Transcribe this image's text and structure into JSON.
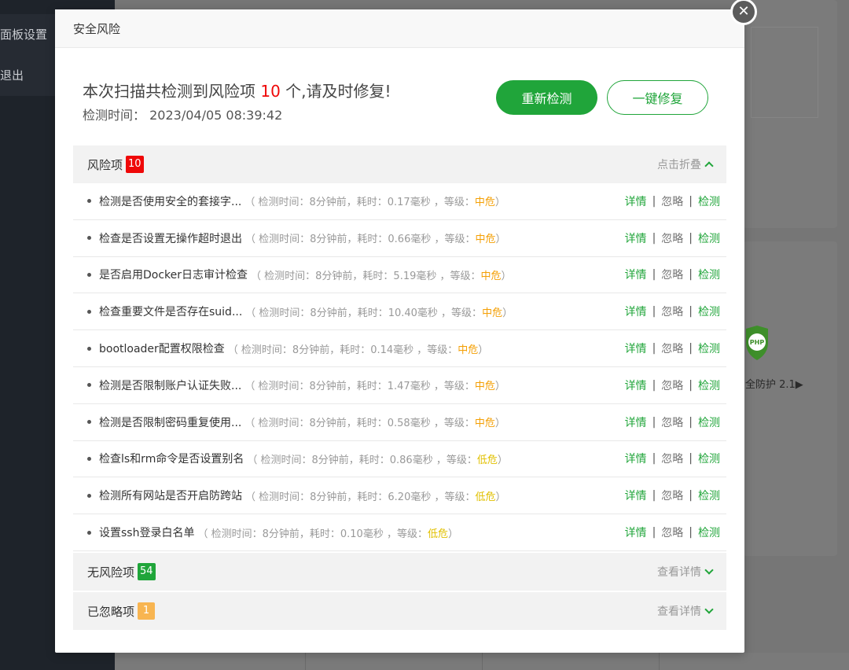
{
  "background": {
    "sidebar_items": [
      "面板设置",
      "退出"
    ],
    "guard_text": "全防护 2.1▶",
    "php_label": "PHP"
  },
  "modal": {
    "title": "安全风险",
    "close_glyph": "✕",
    "summary_prefix": "本次扫描共检测到风险项",
    "summary_count": "10",
    "summary_suffix": "个,请及时修复!",
    "scan_time_label": "检测时间：",
    "scan_time_value": "2023/04/05 08:39:42",
    "rescan_label": "重新检测",
    "fix_all_label": "一键修复",
    "risk_section": {
      "title": "风险项",
      "count": "10",
      "toggle_label": "点击折叠"
    },
    "safe_section": {
      "title": "无风险项",
      "count": "54",
      "toggle_label": "查看详情"
    },
    "ignored_section": {
      "title": "已忽略项",
      "count": "1",
      "toggle_label": "查看详情"
    },
    "actions": {
      "detail": "详情",
      "ignore": "忽略",
      "check": "检测",
      "separator": "|"
    },
    "risks": [
      {
        "name": "检测是否使用安全的套接字...",
        "meta_prefix": "（ 检测时间：8分钟前，耗时：0.17毫秒 ，等级：",
        "level": "中危",
        "meta_suffix": "）",
        "level_type": "mid"
      },
      {
        "name": "检查是否设置无操作超时退出",
        "meta_prefix": "（ 检测时间：8分钟前，耗时：0.66毫秒 ，等级：",
        "level": "中危",
        "meta_suffix": "）",
        "level_type": "mid"
      },
      {
        "name": "是否启用Docker日志审计检查",
        "meta_prefix": "（ 检测时间：8分钟前，耗时：5.19毫秒 ，等级：",
        "level": "中危",
        "meta_suffix": "）",
        "level_type": "mid"
      },
      {
        "name": "检查重要文件是否存在suid...",
        "meta_prefix": "（ 检测时间：8分钟前，耗时：10.40毫秒 ，等级：",
        "level": "中危",
        "meta_suffix": "）",
        "level_type": "mid"
      },
      {
        "name": "bootloader配置权限检查",
        "meta_prefix": "（ 检测时间：8分钟前，耗时：0.14毫秒 ，等级：",
        "level": "中危",
        "meta_suffix": "）",
        "level_type": "mid"
      },
      {
        "name": "检测是否限制账户认证失败...",
        "meta_prefix": "（ 检测时间：8分钟前，耗时：1.47毫秒 ，等级：",
        "level": "中危",
        "meta_suffix": "）",
        "level_type": "mid"
      },
      {
        "name": "检测是否限制密码重复使用...",
        "meta_prefix": "（ 检测时间：8分钟前，耗时：0.58毫秒 ，等级：",
        "level": "中危",
        "meta_suffix": "）",
        "level_type": "mid"
      },
      {
        "name": "检查ls和rm命令是否设置别名",
        "meta_prefix": "（ 检测时间：8分钟前，耗时：0.86毫秒 ，等级：",
        "level": "低危",
        "meta_suffix": "）",
        "level_type": "low"
      },
      {
        "name": "检测所有网站是否开启防跨站",
        "meta_prefix": "（ 检测时间：8分钟前，耗时：6.20毫秒 ，等级：",
        "level": "低危",
        "meta_suffix": "）",
        "level_type": "low"
      },
      {
        "name": "设置ssh登录白名单",
        "meta_prefix": "（ 检测时间：8分钟前，耗时：0.10毫秒 ，等级：",
        "level": "低危",
        "meta_suffix": "）",
        "level_type": "low"
      }
    ]
  },
  "colors": {
    "accent_green": "#20a53a",
    "danger_red": "#ef0808",
    "level_mid": "#f49f04",
    "level_low": "#e1c000",
    "ignored_badge": "#f8b551"
  }
}
